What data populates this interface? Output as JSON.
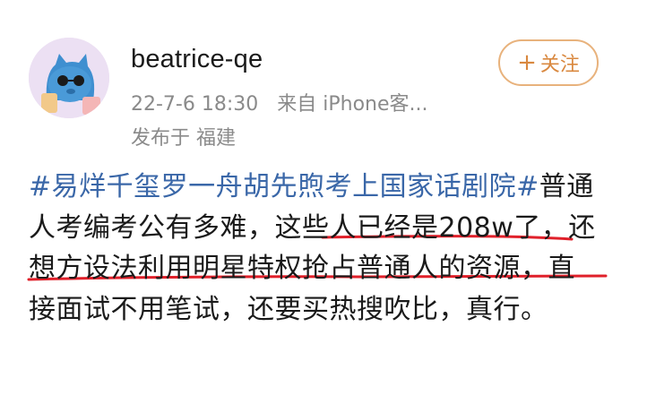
{
  "header": {
    "username": "beatrice-qe",
    "date": "22-7-6 18:30",
    "source": "来自 iPhone客...",
    "location": "发布于 福建",
    "follow_label": "关注",
    "follow_plus": "+"
  },
  "post": {
    "hashtag": "#易烊千玺罗一舟胡先煦考上国家话剧院#",
    "text1": "普通人考编考公有多难，",
    "highlight1": "这些人已经是208w",
    "highlight2": "了，还想方设法利用明星特权抢占普通人的",
    "text2": "资源，直接面试不用笔试，还要买热搜吹比，真行。"
  },
  "colors": {
    "hashtag": "#3a67a8",
    "accent": "#d9883f",
    "underline": "#e0202a"
  }
}
